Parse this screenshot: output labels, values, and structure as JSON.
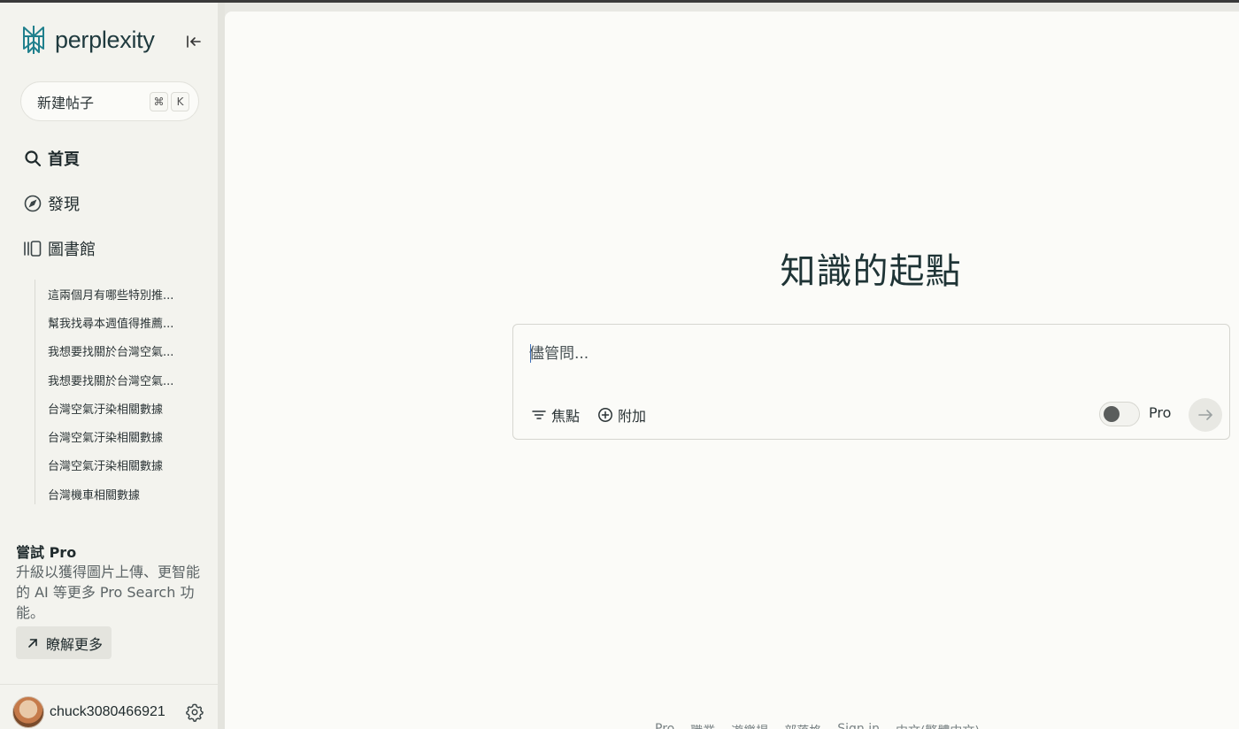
{
  "app": {
    "name": "perplexity"
  },
  "sidebar": {
    "new_thread_label": "新建帖子",
    "shortcut_keys": [
      "⌘",
      "K"
    ],
    "nav": [
      {
        "label": "首頁",
        "icon": "search-icon"
      },
      {
        "label": "發現",
        "icon": "compass-icon"
      },
      {
        "label": "圖書館",
        "icon": "library-icon"
      }
    ],
    "library_items": [
      "這兩個月有哪些特別推...",
      "幫我找尋本週值得推薦...",
      "我想要找關於台灣空氣...",
      "我想要找關於台灣空氣...",
      "台灣空氣汙染相關數據",
      "台灣空氣汙染相關數據",
      "台灣空氣汙染相關數據",
      "台灣機車相關數據"
    ],
    "pro": {
      "title": "嘗試 Pro",
      "description": "升級以獲得圖片上傳、更智能的 AI 等更多 Pro Search 功能。",
      "learn_more_label": "瞭解更多"
    },
    "user": {
      "name": "chuck3080466921"
    }
  },
  "main": {
    "headline": "知識的起點",
    "search": {
      "placeholder": "儘管問...",
      "value": "",
      "focus_label": "焦點",
      "attach_label": "附加",
      "pro_toggle_label": "Pro",
      "pro_enabled": false
    },
    "footer_links": [
      "Pro",
      "職業",
      "遊樂場",
      "部落格",
      "Sign in",
      "中文(繁體中文)"
    ]
  },
  "colors": {
    "brand": "#1f3a3e",
    "logo_teal": "#20808d",
    "sidebar_bg": "#f3f3ee",
    "main_bg": "#fbfbf8"
  }
}
